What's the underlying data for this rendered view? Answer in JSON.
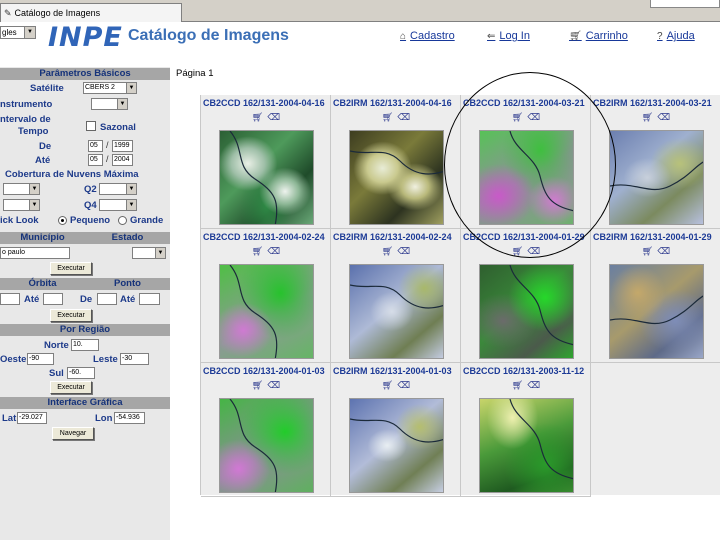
{
  "browser": {
    "tab_title": "Catálogo de Imagens"
  },
  "header": {
    "language": "gles",
    "logo": "INPE",
    "title": "Catálogo de Imagens",
    "links": [
      {
        "label": "Cadastro",
        "icon": "house-icon"
      },
      {
        "label": "Log In",
        "icon": "arrow-left-icon"
      },
      {
        "label": "Carrinho",
        "icon": "cart-icon"
      },
      {
        "label": "Ajuda",
        "icon": "question-icon"
      }
    ]
  },
  "left": {
    "basic_params": {
      "header": "Parâmetros Básicos",
      "satellite_label": "Satélite",
      "satellite_value": "CBERS 2",
      "instrument_label": "nstrumento",
      "interval_label_1": "ntervalo de",
      "interval_label_2": "Tempo",
      "seasonal_label": "Sazonal",
      "from_label": "De",
      "from_month": "05",
      "from_year": "1999",
      "to_label": "Até",
      "to_month": "05",
      "to_year": "2004",
      "cloud_header": "Cobertura de Nuvens Máxima",
      "q2_label": "Q2",
      "q4_label": "Q4",
      "quicklook_label": "ick Look",
      "small_label": "Pequeno",
      "large_label": "Grande"
    },
    "municipio": {
      "header_left": "Município",
      "header_right": "Estado",
      "value": "o paulo",
      "search_button": "Executar"
    },
    "orbita": {
      "header_left": "Órbita",
      "header_right": "Ponto",
      "ate1": "Até",
      "de": "De",
      "ate2": "Até",
      "search_button": "Executar"
    },
    "region": {
      "header": "Por Região",
      "north_label": "Norte",
      "north_value": "10.",
      "west_label": "Oeste",
      "west_value": "-90",
      "east_label": "Leste",
      "east_value": "-30",
      "south_label": "Sul",
      "south_value": "-60.",
      "search_button": "Executar"
    },
    "graphic": {
      "header": "Interface Gráfica",
      "lat_label": "Lat",
      "lat_value": "-29.027",
      "lon_label": "Lon",
      "lon_value": "-54.936",
      "nav_button": "Navegar"
    }
  },
  "main": {
    "page_label": "Página 1",
    "images": [
      {
        "title": "CB2CCD 162/131-2004-04-16",
        "look": "img-a"
      },
      {
        "title": "CB2IRM 162/131-2004-04-16",
        "look": "img-b"
      },
      {
        "title": "CB2CCD 162/131-2004-03-21",
        "look": "img-c"
      },
      {
        "title": "CB2IRM 162/131-2004-03-21",
        "look": "img-d"
      },
      {
        "title": "CB2CCD 162/131-2004-02-24",
        "look": "img-e"
      },
      {
        "title": "CB2IRM 162/131-2004-02-24",
        "look": "img-f"
      },
      {
        "title": "CB2CCD 162/131-2004-01-29",
        "look": "img-g"
      },
      {
        "title": "CB2IRM 162/131-2004-01-29",
        "look": "img-h"
      },
      {
        "title": "CB2CCD 162/131-2004-01-03",
        "look": "img-i"
      },
      {
        "title": "CB2IRM 162/131-2004-01-03",
        "look": "img-j"
      },
      {
        "title": "CB2CCD 162/131-2003-11-12",
        "look": "img-k"
      }
    ]
  }
}
